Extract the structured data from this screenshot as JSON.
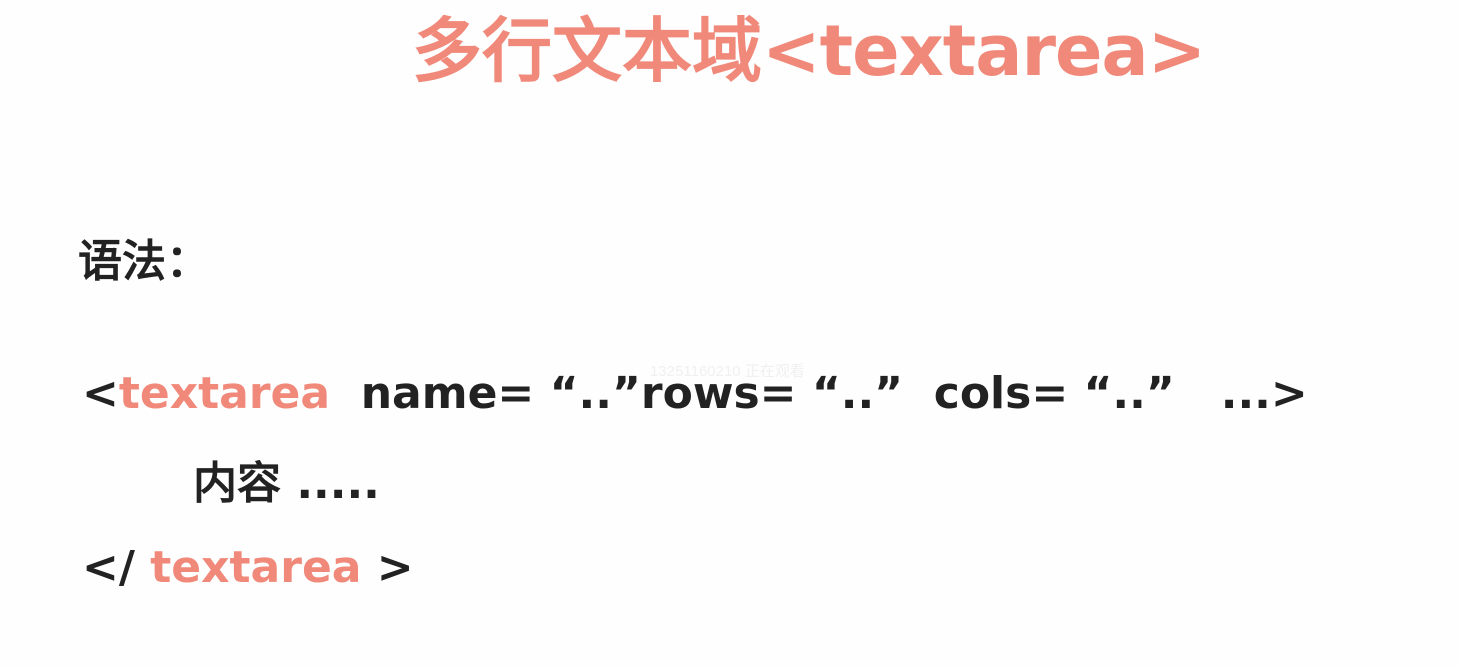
{
  "title": {
    "chinese": "多行文本域",
    "tag": "<textarea>"
  },
  "syntax_label": "语法：",
  "code": {
    "line1": {
      "open": "<",
      "tag": "textarea",
      "rest": "  name= “..”rows= “..”  cols= “..”   ...>"
    },
    "line2": "内容 .....",
    "line3": {
      "open": "</ ",
      "tag": "textarea",
      "close": " >"
    }
  },
  "watermark": "13251160210 正在观看",
  "colors": {
    "accent": "#f0897a",
    "text": "#222222",
    "background": "#fefefe"
  }
}
